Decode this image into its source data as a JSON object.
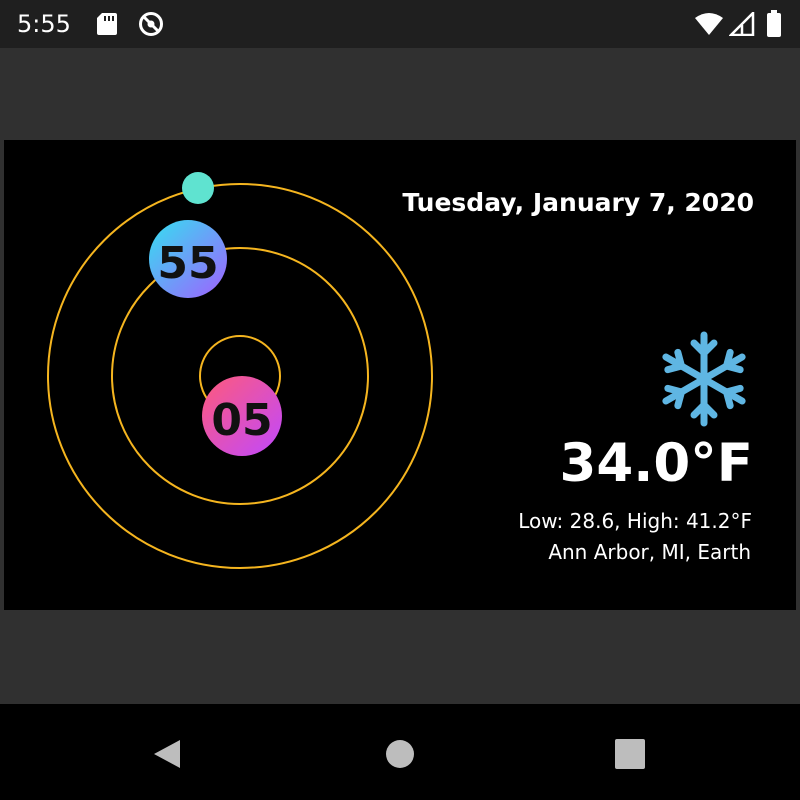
{
  "status_bar": {
    "time": "5:55",
    "icons": [
      "sd-card-icon",
      "no-entry-icon",
      "wifi-icon",
      "signal-icon",
      "battery-icon"
    ]
  },
  "clock": {
    "minute_label": "55",
    "hour_label": "05",
    "ring_color": "#f5b51f",
    "seconds_dot_color": "#5fe3d0"
  },
  "weather": {
    "date": "Tuesday, January 7, 2020",
    "icon": "snowflake-icon",
    "icon_color": "#5fb6e3",
    "temperature": "34.0°F",
    "low_high": "Low: 28.6, High: 41.2°F",
    "location": "Ann Arbor, MI, Earth"
  },
  "nav_bar": {
    "buttons": [
      "back-button",
      "home-button",
      "recents-button"
    ]
  }
}
